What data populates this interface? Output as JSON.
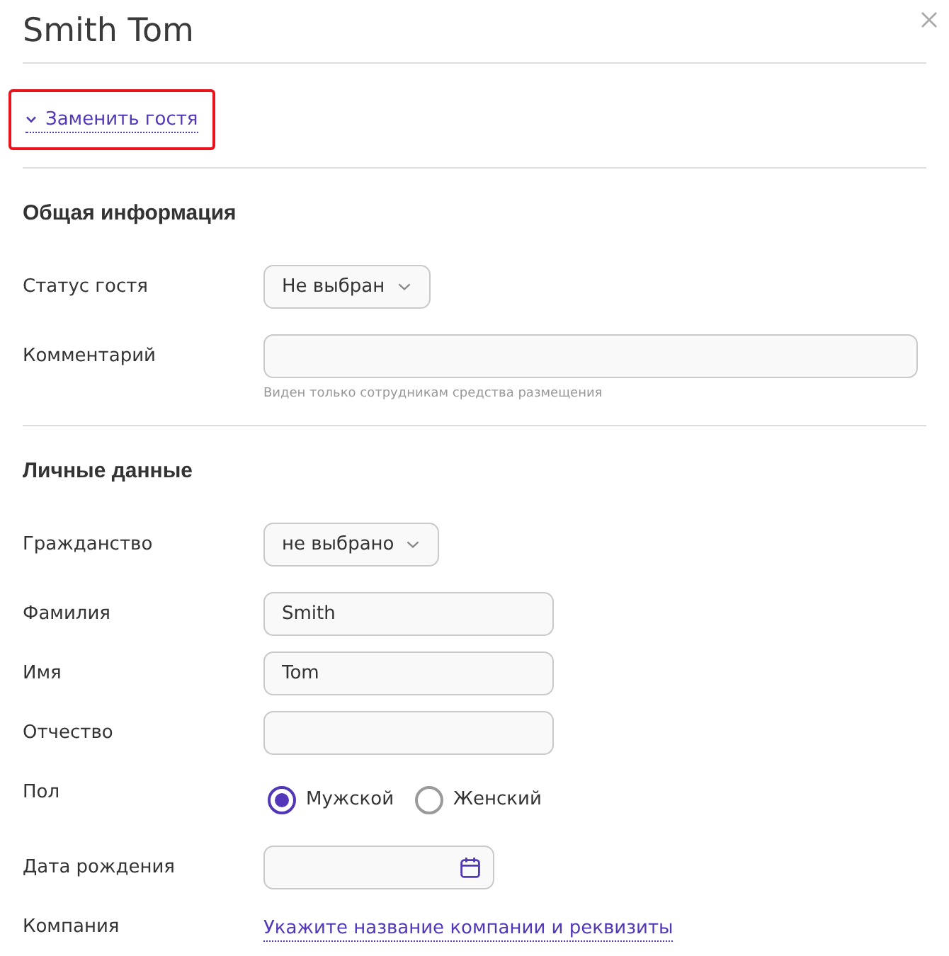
{
  "dialog": {
    "title": "Smith Tom"
  },
  "replace_guest": {
    "label": "Заменить гостя",
    "expanded": false,
    "highlighted": true
  },
  "sections": [
    {
      "title": "Общая информация",
      "fields": [
        {
          "kind": "select",
          "label": "Статус гостя",
          "value": "Не выбран"
        },
        {
          "kind": "comment",
          "label": "Комментарий",
          "hint": "Виден только сотрудникам средства размещения"
        }
      ]
    },
    {
      "title": "Личные данные",
      "fields": [
        {
          "kind": "select",
          "label": "Гражданство",
          "value": "не выбрано"
        },
        {
          "kind": "text",
          "label": "Фамилия",
          "value": "Smith"
        },
        {
          "kind": "text",
          "label": "Имя",
          "value": "Tom"
        },
        {
          "kind": "text",
          "label": "Отчество"
        },
        {
          "kind": "radio",
          "label": "Пол",
          "options": [
            {
              "label": "Мужской",
              "selected": true
            },
            {
              "label": "Женский",
              "selected": false
            }
          ]
        },
        {
          "kind": "date",
          "label": "Дата рождения"
        },
        {
          "kind": "link",
          "label": "Компания",
          "value": "Укажите название компании и реквизиты"
        }
      ]
    }
  ]
}
